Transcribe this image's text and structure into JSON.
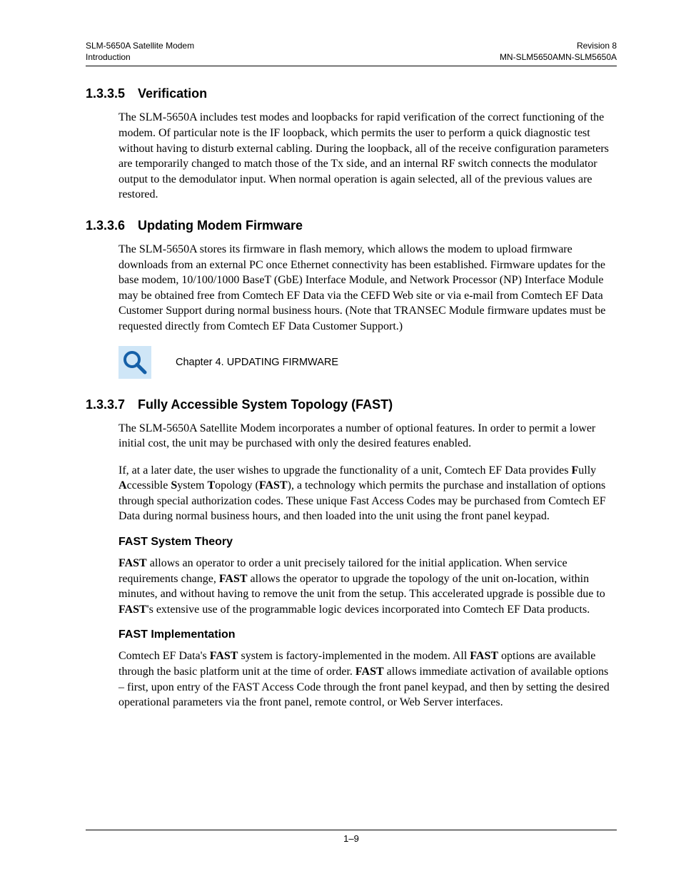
{
  "header": {
    "left_line1": "SLM-5650A Satellite Modem",
    "left_line2": "Introduction",
    "right_line1": "Revision 8",
    "right_line2": "MN-SLM5650AMN-SLM5650A"
  },
  "sections": {
    "s1": {
      "num": "1.3.3.5",
      "title": "Verification",
      "para1": "The SLM-5650A includes test modes and loopbacks for rapid verification of the correct functioning of the modem. Of particular note is the IF loopback, which permits the user to perform a quick diagnostic test without having to disturb external cabling. During the loopback, all of the receive configuration parameters are temporarily changed to match those of the Tx side, and an internal RF switch connects the modulator output to the demodulator input. When normal operation is again selected, all of the previous values are restored."
    },
    "s2": {
      "num": "1.3.3.6",
      "title": "Updating Modem Firmware",
      "para1": "The SLM-5650A stores its firmware in flash memory, which allows the modem to upload firmware downloads from an external PC once Ethernet connectivity has been established. Firmware updates for the base modem, 10/100/1000 BaseT (GbE) Interface Module, and Network Processor (NP) Interface Module may be obtained free from Comtech EF Data via the CEFD Web site or via e-mail from Comtech EF Data Customer Support during normal business hours. (Note that TRANSEC Module firmware updates must be requested directly from Comtech EF Data Customer Support.)",
      "callout_text": "Chapter 4.  UPDATING FIRMWARE"
    },
    "s3": {
      "num": "1.3.3.7",
      "title": "Fully Accessible System Topology (FAST)",
      "para1": "The SLM-5650A Satellite Modem incorporates a number of optional features. In order to permit a lower initial cost, the unit may be purchased with only the desired features enabled.",
      "para2_pre": "If, at a later date, the user wishes to upgrade the functionality of a unit, Comtech EF Data provides ",
      "para2_f": "F",
      "para2_f2": "ully ",
      "para2_a": "A",
      "para2_a2": "ccessible ",
      "para2_s": "S",
      "para2_s2": "ystem ",
      "para2_t": "T",
      "para2_t2": "opology (",
      "para2_fast": "FAST",
      "para2_post": "), a technology which permits the purchase and installation of options through special authorization codes. These unique Fast Access Codes may be purchased from Comtech EF Data during normal business hours, and then loaded into the unit using the front panel keypad.",
      "sub1_title": "FAST System Theory",
      "sub1_b1": "FAST",
      "sub1_t1": " allows an operator to order a unit precisely tailored for the initial application. When service requirements change, ",
      "sub1_b2": "FAST",
      "sub1_t2": " allows the operator to upgrade the topology of the unit on-location, within minutes, and without having to remove the unit from the setup. This accelerated upgrade is possible due to ",
      "sub1_b3": "FAST",
      "sub1_t3": "'s extensive use of the programmable logic devices incorporated into Comtech EF Data products.",
      "sub2_title": "FAST Implementation",
      "sub2_t0": "Comtech EF Data's ",
      "sub2_b1": "FAST",
      "sub2_t1": " system is factory-implemented in the modem. All ",
      "sub2_b2": "FAST",
      "sub2_t2": " options are available through the basic platform unit at the time of order. ",
      "sub2_b3": "FAST",
      "sub2_t3": " allows immediate activation of available options – first, upon entry of the FAST Access Code through the front panel keypad, and then by setting the desired operational parameters via the front panel, remote control, or Web Server interfaces."
    }
  },
  "footer": {
    "page_num": "1–9"
  }
}
